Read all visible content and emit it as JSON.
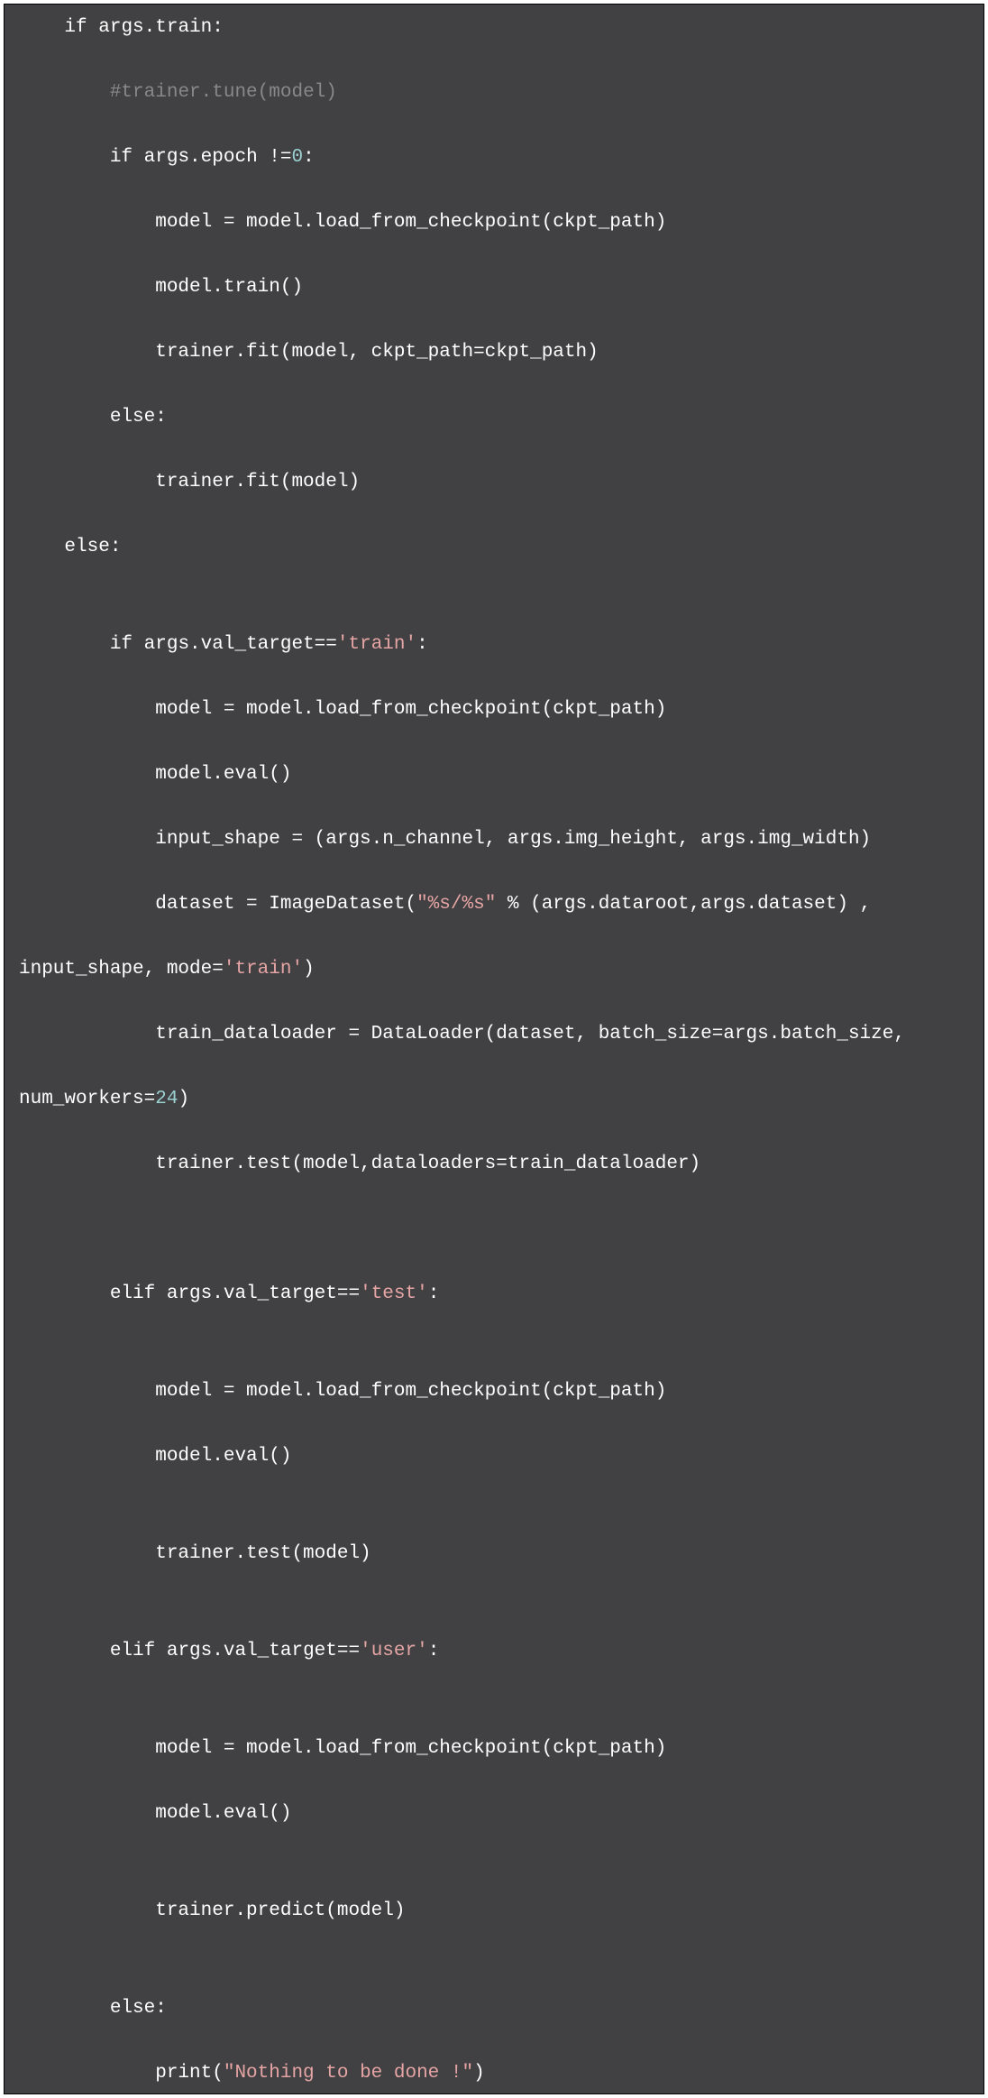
{
  "colors": {
    "background": "#414042",
    "text": "#ffffff",
    "comment": "#888888",
    "string": "#e6a5a5",
    "number": "#9bd1d1"
  },
  "code": [
    [
      [
        "d",
        "    "
      ],
      [
        "kw",
        "if"
      ],
      [
        "d",
        " args.train:"
      ]
    ],
    [
      [
        "d",
        "        "
      ],
      [
        "cm",
        "#trainer.tune(model)"
      ]
    ],
    [
      [
        "d",
        "        "
      ],
      [
        "kw",
        "if"
      ],
      [
        "d",
        " args.epoch !="
      ],
      [
        "nu",
        "0"
      ],
      [
        "d",
        ":"
      ]
    ],
    [
      [
        "d",
        "            model = model.load_from_checkpoint(ckpt_path)"
      ]
    ],
    [
      [
        "d",
        "            model.train()"
      ]
    ],
    [
      [
        "d",
        "            trainer.fit(model, ckpt_path=ckpt_path)"
      ]
    ],
    [
      [
        "d",
        "        "
      ],
      [
        "kw",
        "else"
      ],
      [
        "d",
        ":"
      ]
    ],
    [
      [
        "d",
        "            trainer.fit(model)"
      ]
    ],
    [
      [
        "d",
        "    "
      ],
      [
        "kw",
        "else"
      ],
      [
        "d",
        ":"
      ]
    ],
    [
      [
        "d",
        ""
      ]
    ],
    [
      [
        "d",
        "        "
      ],
      [
        "kw",
        "if"
      ],
      [
        "d",
        " args.val_target=="
      ],
      [
        "st",
        "'train'"
      ],
      [
        "d",
        ":"
      ]
    ],
    [
      [
        "d",
        "            model = model.load_from_checkpoint(ckpt_path)"
      ]
    ],
    [
      [
        "d",
        "            model.eval()"
      ]
    ],
    [
      [
        "d",
        "            input_shape = (args.n_channel, args.img_height, args.img_width)"
      ]
    ],
    [
      [
        "d",
        "            dataset = ImageDataset("
      ],
      [
        "st",
        "\"%s/%s\""
      ],
      [
        "d",
        " % (args.dataroot,args.dataset) , "
      ]
    ],
    [
      [
        "d",
        "input_shape, mode="
      ],
      [
        "st",
        "'train'"
      ],
      [
        "d",
        ")"
      ]
    ],
    [
      [
        "d",
        "            train_dataloader = DataLoader(dataset, batch_size=args.batch_size, "
      ]
    ],
    [
      [
        "d",
        "num_workers="
      ],
      [
        "nu",
        "24"
      ],
      [
        "d",
        ")"
      ]
    ],
    [
      [
        "d",
        "            trainer.test(model,dataloaders=train_dataloader)"
      ]
    ],
    [
      [
        "d",
        ""
      ]
    ],
    [
      [
        "d",
        ""
      ]
    ],
    [
      [
        "d",
        "        "
      ],
      [
        "kw",
        "elif"
      ],
      [
        "d",
        " args.val_target=="
      ],
      [
        "st",
        "'test'"
      ],
      [
        "d",
        ":"
      ]
    ],
    [
      [
        "d",
        ""
      ]
    ],
    [
      [
        "d",
        "            model = model.load_from_checkpoint(ckpt_path)"
      ]
    ],
    [
      [
        "d",
        "            model.eval()"
      ]
    ],
    [
      [
        "d",
        ""
      ]
    ],
    [
      [
        "d",
        "            trainer.test(model)"
      ]
    ],
    [
      [
        "d",
        ""
      ]
    ],
    [
      [
        "d",
        "        "
      ],
      [
        "kw",
        "elif"
      ],
      [
        "d",
        " args.val_target=="
      ],
      [
        "st",
        "'user'"
      ],
      [
        "d",
        ":"
      ]
    ],
    [
      [
        "d",
        ""
      ]
    ],
    [
      [
        "d",
        "            model = model.load_from_checkpoint(ckpt_path)"
      ]
    ],
    [
      [
        "d",
        "            model.eval()"
      ]
    ],
    [
      [
        "d",
        ""
      ]
    ],
    [
      [
        "d",
        "            trainer.predict(model)"
      ]
    ],
    [
      [
        "d",
        ""
      ]
    ],
    [
      [
        "d",
        "        "
      ],
      [
        "kw",
        "else"
      ],
      [
        "d",
        ":"
      ]
    ],
    [
      [
        "d",
        "            print("
      ],
      [
        "st",
        "\"Nothing to be done !\""
      ],
      [
        "d",
        ")"
      ]
    ]
  ]
}
